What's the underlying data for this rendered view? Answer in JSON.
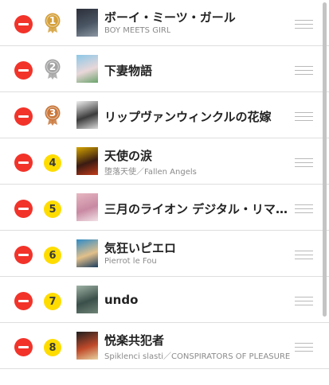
{
  "rows": [
    {
      "rank": "1",
      "title": "ボーイ・ミーツ・ガール",
      "subtitle": "BOY MEETS GIRL",
      "badge": "gold",
      "thumb_colors": [
        "#2b2f3a",
        "#4a5563",
        "#8c97a3"
      ]
    },
    {
      "rank": "2",
      "title": "下妻物語",
      "subtitle": "",
      "badge": "silver",
      "thumb_colors": [
        "#8cc8e8",
        "#e9d7d9",
        "#6aa36b"
      ]
    },
    {
      "rank": "3",
      "title": "リップヴァンウィンクルの花嫁",
      "subtitle": "",
      "badge": "bronze",
      "thumb_colors": [
        "#f0f0f0",
        "#3c3c3c",
        "#dadada"
      ]
    },
    {
      "rank": "4",
      "title": "天使の涙",
      "subtitle": "堕落天使／Fallen Angels",
      "badge": "plain",
      "thumb_colors": [
        "#d5a400",
        "#3a1b12",
        "#c23c1a"
      ]
    },
    {
      "rank": "5",
      "title": "三月のライオン デジタル・リマスター版",
      "subtitle": "",
      "badge": "plain",
      "thumb_colors": [
        "#e7b7c2",
        "#c889a2",
        "#f2e1e6"
      ]
    },
    {
      "rank": "6",
      "title": "気狂いピエロ",
      "subtitle": "Pierrot le Fou",
      "badge": "plain",
      "thumb_colors": [
        "#2e8bc7",
        "#e2c08a",
        "#1b3d5e"
      ]
    },
    {
      "rank": "7",
      "title": "undo",
      "subtitle": "",
      "badge": "plain",
      "thumb_colors": [
        "#9fb3a6",
        "#3b4f4a",
        "#6f8476"
      ]
    },
    {
      "rank": "8",
      "title": "悦楽共犯者",
      "subtitle": "Spiklenci slasti／CONSPIRATORS OF PLEASURE",
      "badge": "plain",
      "thumb_colors": [
        "#1f1f1f",
        "#c04a2a",
        "#e7d2a0"
      ]
    }
  ],
  "colors": {
    "delete": "#f2332a",
    "gold": "#d4a03a",
    "silver": "#a4a4a4",
    "bronze": "#c9773a",
    "rank_badge": "#ffdc00"
  },
  "icons": {
    "delete": "minus-circle-icon",
    "reorder": "drag-handle-icon",
    "medal": "medal-icon"
  }
}
